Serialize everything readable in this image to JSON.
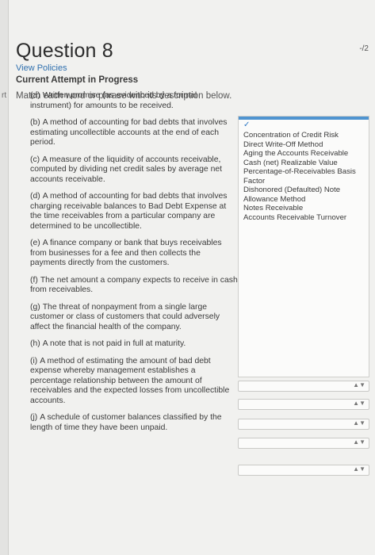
{
  "header": {
    "question_title": "Question 8",
    "view_policies": "View Policies",
    "attempt": "Current Attempt in Progress",
    "instruction": "Match each word or phrase with its description below.",
    "score": "-/2",
    "left_label": "rt"
  },
  "items": [
    {
      "label": "(a)",
      "text": "Written promise (as evidenced by a formal instrument) for amounts to be received."
    },
    {
      "label": "(b)",
      "text": "A method of accounting for bad debts that involves estimating uncollectible accounts at the end of each period."
    },
    {
      "label": "(c)",
      "text": "A measure of the liquidity of accounts receivable, computed by dividing net credit sales by average net accounts receivable."
    },
    {
      "label": "(d)",
      "text": "A method of accounting for bad debts that involves charging receivable balances to Bad Debt Expense at the time receivables from a particular company are determined to be uncollectible."
    },
    {
      "label": "(e)",
      "text": "A finance company or bank that buys receivables from businesses for a fee and then collects the payments directly from the customers."
    },
    {
      "label": "(f)",
      "text": "The net amount a company expects to receive in cash from receivables."
    },
    {
      "label": "(g)",
      "text": "The threat of nonpayment from a single large customer or class of customers that could adversely affect the financial health of the company."
    },
    {
      "label": "(h)",
      "text": "A note that is not paid in full at maturity."
    },
    {
      "label": "(i)",
      "text": "A method of estimating the amount of bad debt expense whereby management establishes a percentage relationship between the amount of receivables and the expected losses from uncollectible accounts."
    },
    {
      "label": "(j)",
      "text": "A schedule of customer balances classified by the length of time they have been unpaid."
    }
  ],
  "options": [
    "Concentration of Credit Risk",
    "Direct Write-Off Method",
    "Aging the Accounts Receivable",
    "Cash (net) Realizable Value",
    "Percentage-of-Receivables Basis",
    "Factor",
    "Dishonored (Defaulted) Note",
    "Allowance Method",
    "Notes Receivable",
    "Accounts Receivable Turnover"
  ],
  "icons": {
    "dropdown_arrow": "updown-arrow-icon",
    "check": "check-icon"
  }
}
